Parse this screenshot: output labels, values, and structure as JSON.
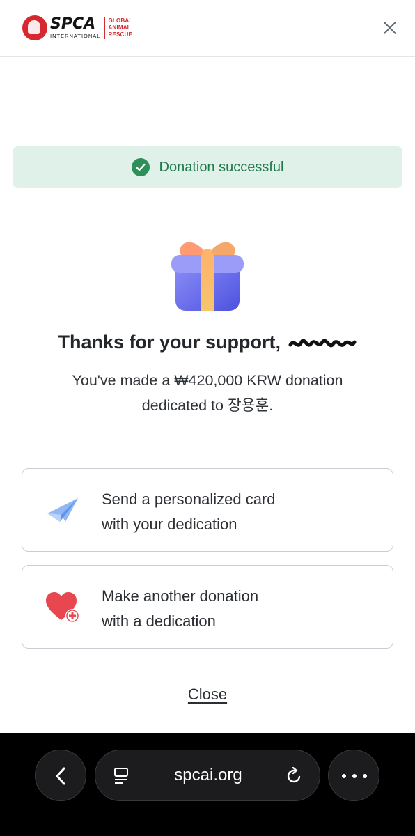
{
  "header": {
    "logo_text": "SPCA",
    "logo_sub": "INTERNATIONAL",
    "logo_tag": [
      "GLOBAL",
      "ANIMAL",
      "RESCUE"
    ],
    "close_icon": "close-icon"
  },
  "banner": {
    "text": "Donation successful",
    "icon": "check-circle-icon",
    "bg_color": "#e0f1ea",
    "text_color": "#1f7a4a"
  },
  "thanks": {
    "title": "Thanks for your support,",
    "amount_line": "You've made a ₩420,000 KRW donation",
    "dedication_line": "dedicated to 장용훈."
  },
  "options": [
    {
      "icon": "paper-plane-icon",
      "line1": "Send a personalized card",
      "line2": "with your dedication"
    },
    {
      "icon": "heart-plus-icon",
      "line1": "Make another donation",
      "line2": "with a dedication"
    }
  ],
  "close_label": "Close",
  "browser": {
    "url": "spcai.org",
    "back_icon": "chevron-left-icon",
    "tabs_icon": "tabs-icon",
    "reload_icon": "reload-icon",
    "more_icon": "more-icon"
  },
  "colors": {
    "brand_red": "#d7282f",
    "success_green": "#2e8f58"
  }
}
